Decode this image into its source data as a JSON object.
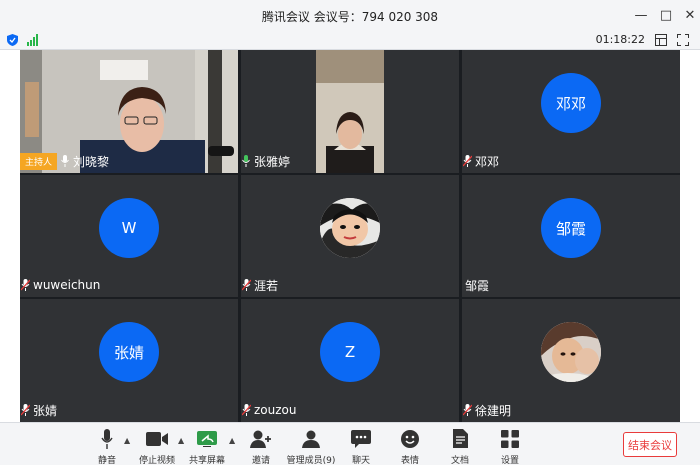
{
  "window": {
    "title": "腾讯会议 会议号：794 020 308",
    "timer": "01:18:22"
  },
  "participants": [
    {
      "name": "刘晓黎",
      "host_label": "主持人"
    },
    {
      "name": "张雅婷"
    },
    {
      "name": "邓邓",
      "avatar_text": "邓邓"
    },
    {
      "name": "wuweichun",
      "avatar_text": "W"
    },
    {
      "name": "涯若"
    },
    {
      "name": "邹霞",
      "avatar_text": "邹霞"
    },
    {
      "name": "张婧",
      "avatar_text": "张婧"
    },
    {
      "name": "zouzou",
      "avatar_text": "Z"
    },
    {
      "name": "徐建明"
    }
  ],
  "toolbar": {
    "mute": "静音",
    "stop_video": "停止视频",
    "share_screen": "共享屏幕",
    "invite": "邀请",
    "members": "管理成员(9)",
    "chat": "聊天",
    "reactions": "表情",
    "docs": "文档",
    "settings": "设置",
    "end_meeting": "结束会议"
  },
  "colors": {
    "accent": "#0b69f4",
    "host": "#f5a623",
    "end": "#e93b3b"
  }
}
